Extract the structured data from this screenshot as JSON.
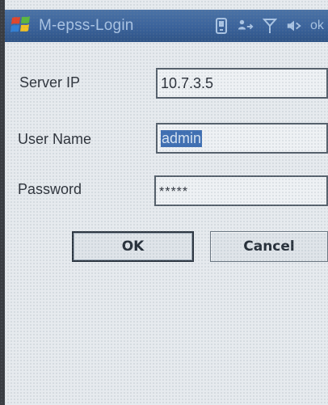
{
  "window": {
    "title": "M-epss-Login",
    "tray_ok": "ok"
  },
  "icons": {
    "start": "windows-flag-icon",
    "tray": [
      "device-icon",
      "connectivity-icon",
      "signal-antenna-icon",
      "speaker-icon"
    ]
  },
  "form": {
    "server_ip_label": "Server IP",
    "server_ip_value": "10.7.3.5",
    "username_label": "User Name",
    "username_value": "admin",
    "password_label": "Password",
    "password_value": "*****"
  },
  "buttons": {
    "ok_label": "OK",
    "cancel_label": "Cancel"
  },
  "colors": {
    "titlebar": "#3a629b",
    "selection": "#3f6fb3",
    "background": "#e6eaee"
  }
}
